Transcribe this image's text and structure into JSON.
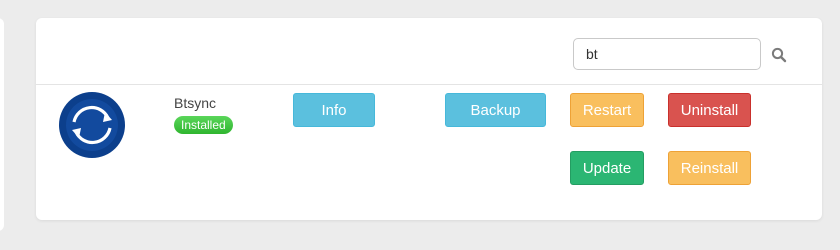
{
  "search": {
    "value": "bt"
  },
  "app": {
    "name": "Btsync",
    "status": "Installed",
    "logo_icon": "sync-arrows-icon"
  },
  "buttons": {
    "info": "Info",
    "backup": "Backup",
    "restart": "Restart",
    "uninstall": "Uninstall",
    "update": "Update",
    "reinstall": "Reinstall"
  },
  "colors": {
    "info": "#5bc0de",
    "warning": "#f9bf5e",
    "danger": "#d9534f",
    "success": "#2bb673",
    "badge": "#3cc43c",
    "logo": "#0c3f8c"
  }
}
